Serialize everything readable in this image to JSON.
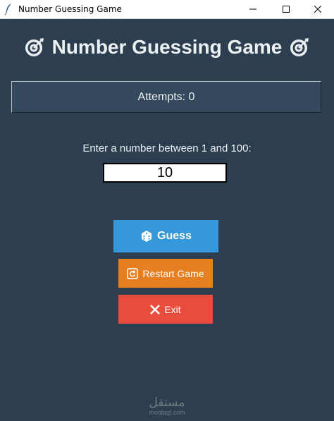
{
  "window": {
    "title": "Number Guessing Game",
    "minimize_icon": "minimize-icon",
    "maximize_icon": "maximize-icon",
    "close_icon": "close-icon"
  },
  "header": {
    "title": "Number Guessing Game",
    "icon": "target-icon"
  },
  "attempts": {
    "text": "Attempts: 0"
  },
  "input": {
    "prompt": "Enter a number between 1 and 100:",
    "value": "10"
  },
  "buttons": {
    "guess_label": "Guess",
    "guess_icon": "dice-icon",
    "restart_label": "Restart Game",
    "restart_icon": "restart-icon",
    "exit_label": "Exit",
    "exit_icon": "x-icon"
  },
  "watermark": {
    "arabic": "مستقل",
    "latin": "mostaql.com"
  },
  "colors": {
    "background": "#2c3e50",
    "guess": "#3498db",
    "restart": "#e67e22",
    "exit": "#e74c3c"
  }
}
